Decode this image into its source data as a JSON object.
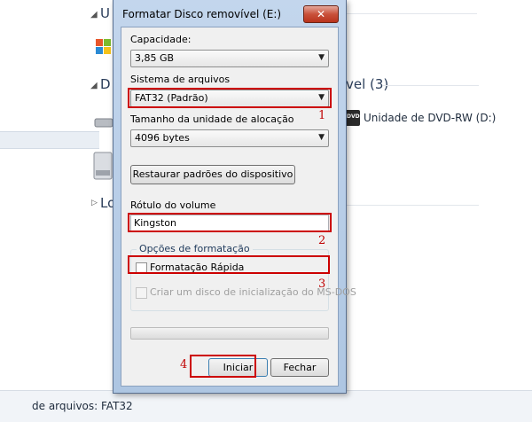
{
  "background": {
    "group1_header_fragment": "U",
    "group2_header_fragment_left": "D",
    "group2_header_fragment_right": "vel (3)",
    "group3_header_fragment": "Lo",
    "dvd_drive_label": "Unidade de DVD-RW (D:)",
    "dvd_badge": "DVD",
    "status_bar_text": "de arquivos:  FAT32"
  },
  "dialog": {
    "title": "Formatar Disco removível (E:)",
    "close_label": "✕",
    "capacity": {
      "label": "Capacidade:",
      "value": "3,85 GB"
    },
    "filesystem": {
      "label": "Sistema de arquivos",
      "value": "FAT32 (Padrão)"
    },
    "allocation": {
      "label": "Tamanho da unidade de alocação",
      "value": "4096 bytes"
    },
    "restore_defaults_label": "Restaurar padrões do dispositivo",
    "volume": {
      "label": "Rótulo do volume",
      "value": "Kingston"
    },
    "format_options": {
      "title": "Opções de formatação",
      "quick_format_label": "Formatação Rápida",
      "quick_format_checked": false,
      "msdos_boot_label": "Criar um disco de inicialização do MS-DOS",
      "msdos_boot_checked": false
    },
    "progress": 0,
    "start_label": "Iniciar",
    "close_button_label": "Fechar"
  },
  "annotations": {
    "highlight_color": "#cc0000",
    "step1": "1",
    "step2": "2",
    "step3": "3",
    "step4": "4"
  }
}
